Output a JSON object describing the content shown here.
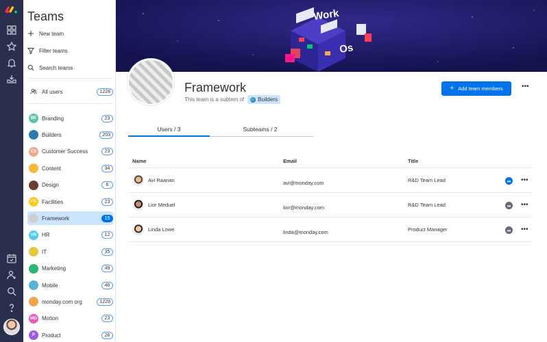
{
  "rail": {
    "icons": [
      "monday-logo",
      "workspaces-icon",
      "favorites-icon",
      "notifications-icon",
      "inbox-icon",
      "my-work-icon",
      "invite-icon",
      "search-icon",
      "help-icon"
    ]
  },
  "sidebar": {
    "title": "Teams",
    "actions": [
      {
        "label": "New team",
        "icon": "plus-icon"
      },
      {
        "label": "Filter teams",
        "icon": "filter-icon"
      },
      {
        "label": "Search teams",
        "icon": "search-icon"
      }
    ],
    "all_users": {
      "label": "All users",
      "count": "1228"
    },
    "teams": [
      {
        "name": "Branding",
        "count": "23",
        "initials": "BE",
        "color": "#5cc6a3"
      },
      {
        "name": "Builders",
        "count": "203",
        "initials": "",
        "color": "#2a7ab0"
      },
      {
        "name": "Customer Success",
        "count": "23",
        "initials": "CS",
        "color": "#f4a58a"
      },
      {
        "name": "Content",
        "count": "34",
        "initials": "",
        "color": "#f6b93b"
      },
      {
        "name": "Design",
        "count": "6",
        "initials": "",
        "color": "#6b3e2e"
      },
      {
        "name": "Facilities",
        "count": "23",
        "initials": "FA",
        "color": "#fdca1d"
      },
      {
        "name": "Framework",
        "count": "15",
        "initials": "",
        "color": "#cfcfcf"
      },
      {
        "name": "HR",
        "count": "12",
        "initials": "HR",
        "color": "#4eccf6"
      },
      {
        "name": "IT",
        "count": "35",
        "initials": "",
        "color": "#e5c83b"
      },
      {
        "name": "Marketing",
        "count": "49",
        "initials": "",
        "color": "#2bb673"
      },
      {
        "name": "Mobile",
        "count": "46",
        "initials": "",
        "color": "#56b4d3"
      },
      {
        "name": "monday.com org",
        "count": "1228",
        "initials": "",
        "color": "#f0a44b"
      },
      {
        "name": "Motion",
        "count": "23",
        "initials": "MO",
        "color": "#e55bc0"
      },
      {
        "name": "Product",
        "count": "26",
        "initials": "P",
        "color": "#9b5de5"
      }
    ]
  },
  "header": {
    "title": "Framework",
    "subteam_text": "This team is a subtem of",
    "parent_team": "Builders",
    "add_button": "Add team members"
  },
  "tabs": [
    {
      "label": "Users / 3"
    },
    {
      "label": "Subteams / 2"
    }
  ],
  "table": {
    "columns": [
      "Name",
      "Email",
      "Title"
    ],
    "rows": [
      {
        "name": "Avi Raanan",
        "email": "avi@monday.com",
        "title": "R&D Team Lead",
        "role_color": "#0073ea"
      },
      {
        "name": "Lior Meduel",
        "email": "lior@monday.com",
        "title": "R&D Team Lead",
        "role_color": "#676879"
      },
      {
        "name": "Linda Lowe",
        "email": "linda@monday.com",
        "title": "Product Manager",
        "role_color": "#676879"
      }
    ]
  },
  "banner_text": [
    "Work",
    "Os"
  ]
}
